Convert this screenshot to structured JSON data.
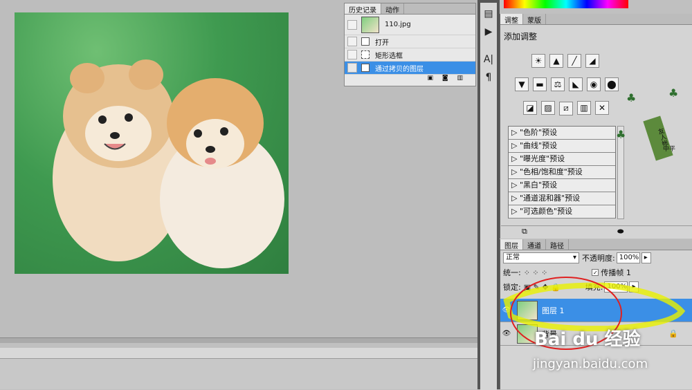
{
  "history_panel": {
    "tabs": [
      "历史记录",
      "动作"
    ],
    "snapshot_name": "110.jpg",
    "items": [
      "打开",
      "矩形选框",
      "通过拷贝的图层"
    ]
  },
  "adjustments_panel": {
    "tabs": [
      "调整",
      "蒙版"
    ],
    "title": "添加调整",
    "presets": [
      "\"色阶\"预设",
      "\"曲线\"预设",
      "\"曝光度\"预设",
      "\"色相/饱和度\"预设",
      "\"黑白\"预设",
      "\"通道混和器\"预设",
      "\"可选颜色\"预设"
    ]
  },
  "layers_panel": {
    "tabs": [
      "图层",
      "通道",
      "路径"
    ],
    "blend_mode": "正常",
    "opacity_label": "不透明度:",
    "opacity_value": "100%",
    "unify_label": "统一:",
    "propagate_label": "传播帧 1",
    "lock_label": "锁定:",
    "fill_label": "填充:",
    "fill_value": "100%",
    "layers": [
      {
        "name": "图层 1",
        "selected": true
      },
      {
        "name": "背景",
        "selected": false
      }
    ]
  },
  "decoration": {
    "seal_text": "友人帐",
    "sub_text": "中平"
  },
  "watermark": {
    "logo": "Bai du 经验",
    "url": "jingyan.baidu.com"
  },
  "colors": {
    "selection": "#3b8fe6",
    "annotation_red": "#e02020",
    "annotation_yellow": "#e8f000"
  }
}
